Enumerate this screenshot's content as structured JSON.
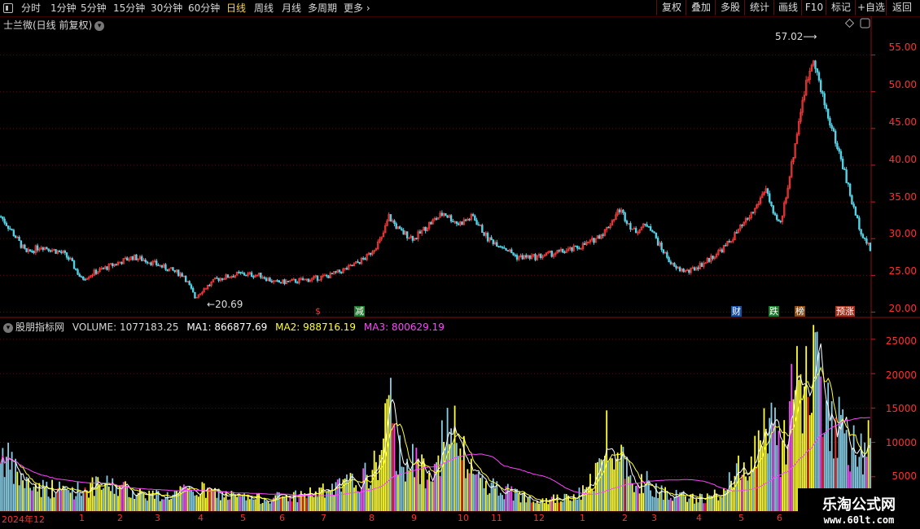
{
  "toolbar": {
    "periods": [
      "分时",
      "1分钟",
      "5分钟",
      "15分钟",
      "30分钟",
      "60分钟",
      "日线",
      "周线",
      "月线",
      "多周期",
      "更多"
    ],
    "active_period": "日线",
    "right_buttons": [
      "复权",
      "叠加",
      "多股",
      "统计",
      "画线",
      "F10",
      "标记",
      "+自选",
      "返回"
    ]
  },
  "chart_title": "士兰微(日线 前复权)",
  "price_axis": [
    "55.00",
    "50.00",
    "45.00",
    "40.00",
    "35.00",
    "30.00",
    "25.00",
    "20.00"
  ],
  "volume_axis": [
    "25000",
    "20000",
    "15000",
    "10000",
    "5000"
  ],
  "annotations": {
    "high": "57.02",
    "low": "20.69"
  },
  "tags": [
    {
      "text": "$",
      "color": "#ff3030",
      "bg": "transparent"
    },
    {
      "text": "减",
      "color": "#ffffff",
      "bg": "#1b7a2a"
    },
    {
      "text": "财",
      "color": "#ffffff",
      "bg": "#1a4fa0"
    },
    {
      "text": "跌",
      "color": "#ffffff",
      "bg": "#1b7a2a"
    },
    {
      "text": "榜",
      "color": "#ffffff",
      "bg": "#8a4b12"
    },
    {
      "text": "预涨",
      "color": "#ffffff",
      "bg": "#a0301a"
    }
  ],
  "volume_legend": {
    "name": "股朋指标网",
    "volume": "VOLUME: 1077183.25",
    "ma1": "MA1: 866877.69",
    "ma2": "MA2: 988716.19",
    "ma3": "MA3: 800629.19",
    "colors": {
      "name": "#d8d8d8",
      "volume": "#d8d8d8",
      "ma1": "#ffffff",
      "ma2": "#ffff33",
      "ma3": "#ff44ff"
    }
  },
  "x_axis": [
    "2024年12",
    "1",
    "2",
    "3",
    "4",
    "5",
    "6",
    "7",
    "8",
    "9",
    "10",
    "11",
    "12",
    "1",
    "2",
    "3",
    "4",
    "5",
    "6"
  ],
  "watermark": {
    "line1": "乐淘公式网",
    "line2": "www.60lt.com"
  },
  "chart_data": {
    "type": "candlestick",
    "price_range": [
      19.5,
      58.5
    ],
    "volume_range": [
      0,
      27000
    ],
    "price_anchors": [
      [
        0,
        33
      ],
      [
        6,
        31
      ],
      [
        14,
        28
      ],
      [
        22,
        29
      ],
      [
        28,
        28.5
      ],
      [
        34,
        28
      ],
      [
        38,
        27
      ],
      [
        44,
        24.5
      ],
      [
        52,
        25.5
      ],
      [
        62,
        26.5
      ],
      [
        72,
        27.5
      ],
      [
        80,
        27
      ],
      [
        90,
        26
      ],
      [
        100,
        25
      ],
      [
        106,
        22
      ],
      [
        110,
        23
      ],
      [
        118,
        24.5
      ],
      [
        130,
        25.2
      ],
      [
        142,
        25
      ],
      [
        150,
        24
      ],
      [
        160,
        24.2
      ],
      [
        170,
        24.5
      ],
      [
        180,
        25
      ],
      [
        190,
        26
      ],
      [
        200,
        27.5
      ],
      [
        208,
        30
      ],
      [
        212,
        33
      ],
      [
        218,
        31
      ],
      [
        226,
        30
      ],
      [
        234,
        32
      ],
      [
        242,
        33.5
      ],
      [
        250,
        32
      ],
      [
        258,
        33
      ],
      [
        266,
        30
      ],
      [
        274,
        29
      ],
      [
        282,
        27.5
      ],
      [
        292,
        27.5
      ],
      [
        302,
        28
      ],
      [
        312,
        28.5
      ],
      [
        322,
        29.5
      ],
      [
        330,
        31
      ],
      [
        338,
        34
      ],
      [
        346,
        31
      ],
      [
        354,
        32
      ],
      [
        360,
        29
      ],
      [
        368,
        26
      ],
      [
        376,
        25.5
      ],
      [
        386,
        27
      ],
      [
        396,
        29
      ],
      [
        406,
        32
      ],
      [
        412,
        34
      ],
      [
        418,
        37
      ],
      [
        422,
        33
      ],
      [
        426,
        32
      ],
      [
        432,
        40
      ],
      [
        438,
        49
      ],
      [
        444,
        55
      ],
      [
        448,
        50
      ],
      [
        454,
        45
      ],
      [
        460,
        40
      ],
      [
        466,
        34
      ],
      [
        470,
        31
      ],
      [
        475,
        28.5
      ]
    ],
    "volume_anchors": [
      [
        0,
        9000
      ],
      [
        6,
        6000
      ],
      [
        14,
        4000
      ],
      [
        22,
        3500
      ],
      [
        30,
        3200
      ],
      [
        40,
        3000
      ],
      [
        50,
        3500
      ],
      [
        60,
        3800
      ],
      [
        70,
        3000
      ],
      [
        80,
        2500
      ],
      [
        90,
        2200
      ],
      [
        100,
        2800
      ],
      [
        110,
        3000
      ],
      [
        120,
        2500
      ],
      [
        130,
        2000
      ],
      [
        140,
        1800
      ],
      [
        150,
        2000
      ],
      [
        160,
        2200
      ],
      [
        170,
        2600
      ],
      [
        180,
        3000
      ],
      [
        190,
        4000
      ],
      [
        200,
        5000
      ],
      [
        206,
        7000
      ],
      [
        212,
        15000
      ],
      [
        216,
        9000
      ],
      [
        224,
        7000
      ],
      [
        232,
        6000
      ],
      [
        240,
        9000
      ],
      [
        246,
        12000
      ],
      [
        252,
        8000
      ],
      [
        260,
        5000
      ],
      [
        270,
        3500
      ],
      [
        280,
        2500
      ],
      [
        290,
        2000
      ],
      [
        300,
        1800
      ],
      [
        310,
        1800
      ],
      [
        320,
        3000
      ],
      [
        326,
        6000
      ],
      [
        332,
        12000
      ],
      [
        338,
        8000
      ],
      [
        346,
        5000
      ],
      [
        354,
        4000
      ],
      [
        362,
        3000
      ],
      [
        370,
        2200
      ],
      [
        380,
        1800
      ],
      [
        390,
        2200
      ],
      [
        398,
        4000
      ],
      [
        406,
        7000
      ],
      [
        414,
        10000
      ],
      [
        420,
        14000
      ],
      [
        426,
        9000
      ],
      [
        432,
        15000
      ],
      [
        438,
        19000
      ],
      [
        444,
        20000
      ],
      [
        450,
        16000
      ],
      [
        456,
        13000
      ],
      [
        462,
        10000
      ],
      [
        468,
        8000
      ],
      [
        475,
        9500
      ]
    ]
  }
}
